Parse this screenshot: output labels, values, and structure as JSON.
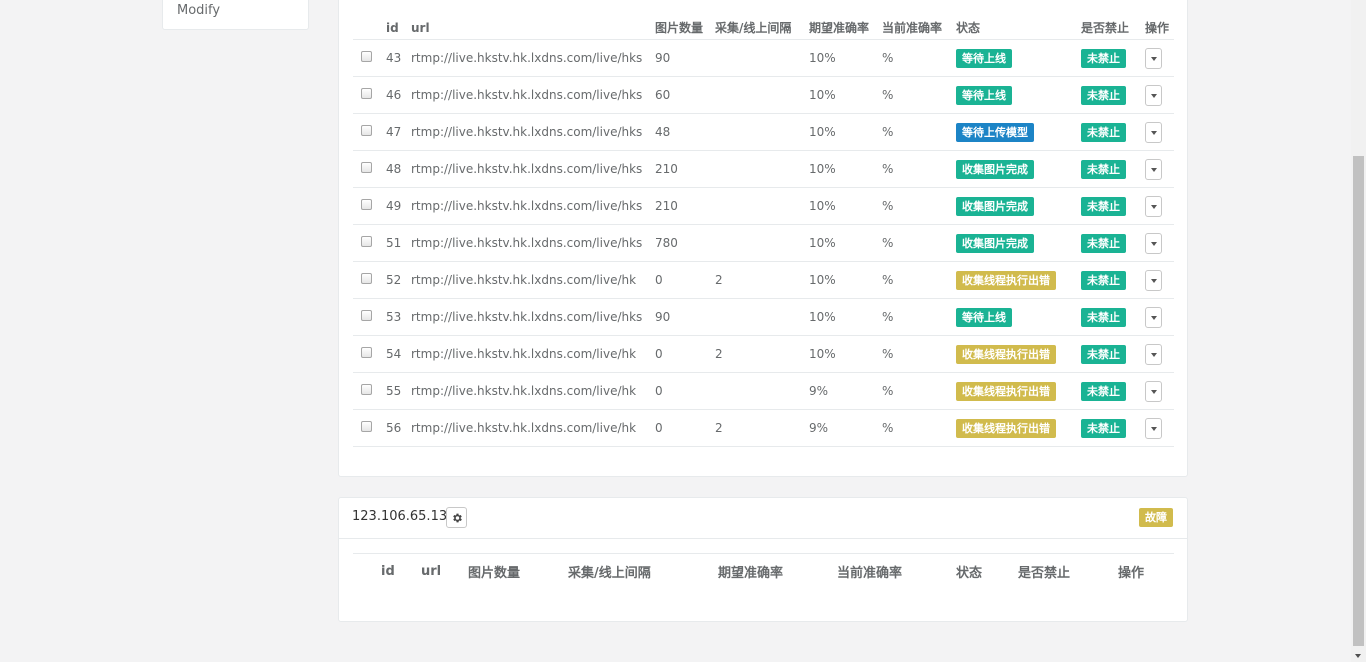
{
  "sidebar": {
    "modify_label": "Modify"
  },
  "table1": {
    "headers": [
      "id",
      "url",
      "图片数量",
      "采集/线上间隔",
      "期望准确率",
      "当前准确率",
      "状态",
      "是否禁止",
      "操作"
    ],
    "rows": [
      {
        "id": "43",
        "url": "rtmp://live.hkstv.hk.lxdns.com/live/hks",
        "count": "90",
        "interval": "",
        "expected": "10%",
        "current": "%",
        "status": "等待上线",
        "status_color": "green",
        "ban": "未禁止"
      },
      {
        "id": "46",
        "url": "rtmp://live.hkstv.hk.lxdns.com/live/hks",
        "count": "60",
        "interval": "",
        "expected": "10%",
        "current": "%",
        "status": "等待上线",
        "status_color": "green",
        "ban": "未禁止"
      },
      {
        "id": "47",
        "url": "rtmp://live.hkstv.hk.lxdns.com/live/hks",
        "count": "48",
        "interval": "",
        "expected": "10%",
        "current": "%",
        "status": "等待上传模型",
        "status_color": "blue",
        "ban": "未禁止"
      },
      {
        "id": "48",
        "url": "rtmp://live.hkstv.hk.lxdns.com/live/hks",
        "count": "210",
        "interval": "",
        "expected": "10%",
        "current": "%",
        "status": "收集图片完成",
        "status_color": "green",
        "ban": "未禁止"
      },
      {
        "id": "49",
        "url": "rtmp://live.hkstv.hk.lxdns.com/live/hks",
        "count": "210",
        "interval": "",
        "expected": "10%",
        "current": "%",
        "status": "收集图片完成",
        "status_color": "green",
        "ban": "未禁止"
      },
      {
        "id": "51",
        "url": "rtmp://live.hkstv.hk.lxdns.com/live/hks",
        "count": "780",
        "interval": "",
        "expected": "10%",
        "current": "%",
        "status": "收集图片完成",
        "status_color": "green",
        "ban": "未禁止"
      },
      {
        "id": "52",
        "url": "rtmp://live.hkstv.hk.lxdns.com/live/hk",
        "count": "0",
        "interval": "2",
        "expected": "10%",
        "current": "%",
        "status": "收集线程执行出错",
        "status_color": "yellow",
        "ban": "未禁止"
      },
      {
        "id": "53",
        "url": "rtmp://live.hkstv.hk.lxdns.com/live/hks",
        "count": "90",
        "interval": "",
        "expected": "10%",
        "current": "%",
        "status": "等待上线",
        "status_color": "green",
        "ban": "未禁止"
      },
      {
        "id": "54",
        "url": "rtmp://live.hkstv.hk.lxdns.com/live/hk",
        "count": "0",
        "interval": "2",
        "expected": "10%",
        "current": "%",
        "status": "收集线程执行出错",
        "status_color": "yellow",
        "ban": "未禁止"
      },
      {
        "id": "55",
        "url": "rtmp://live.hkstv.hk.lxdns.com/live/hk",
        "count": "0",
        "interval": "",
        "expected": "9%",
        "current": "%",
        "status": "收集线程执行出错",
        "status_color": "yellow",
        "ban": "未禁止"
      },
      {
        "id": "56",
        "url": "rtmp://live.hkstv.hk.lxdns.com/live/hk",
        "count": "0",
        "interval": "2",
        "expected": "9%",
        "current": "%",
        "status": "收集线程执行出错",
        "status_color": "yellow",
        "ban": "未禁止"
      }
    ]
  },
  "panel2": {
    "ip": "123.106.65.138",
    "gear_icon": "gear-icon",
    "fault_label": "故障",
    "headers": [
      "id",
      "url",
      "图片数量",
      "采集/线上间隔",
      "期望准确率",
      "当前准确率",
      "状态",
      "是否禁止",
      "操作"
    ]
  },
  "colors": {
    "green": "#1ab394",
    "blue": "#1c84c6",
    "yellow": "#d1bb4d"
  }
}
